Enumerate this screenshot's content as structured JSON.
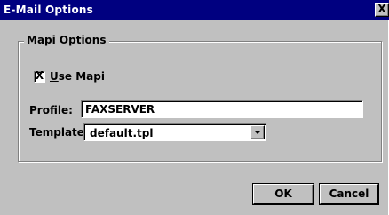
{
  "window": {
    "title": "E-Mail Options",
    "close_glyph": "X"
  },
  "group": {
    "legend": "Mapi Options",
    "use_mapi": {
      "label_underlined": "U",
      "label_rest": "se Mapi",
      "checked": true,
      "check_glyph": "X"
    },
    "profile": {
      "label": "Profile:",
      "value": "FAXSERVER"
    },
    "template": {
      "label": "Template:",
      "value": "default.tpl"
    }
  },
  "buttons": {
    "ok": "OK",
    "cancel": "Cancel"
  }
}
